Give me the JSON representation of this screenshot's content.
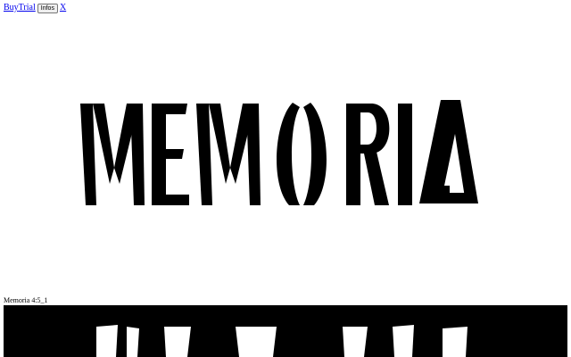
{
  "nav": {
    "buy_label": "Buy",
    "trial_label": "Trial",
    "infos_label": "Infos",
    "close_label": "X"
  },
  "hero": {
    "specimen_text": "MEMORIA"
  },
  "specimen": {
    "caption": "Memoria 4:5_1"
  },
  "colors": {
    "background": "#ffffff",
    "ink": "#000000",
    "link": "#0000ee"
  }
}
